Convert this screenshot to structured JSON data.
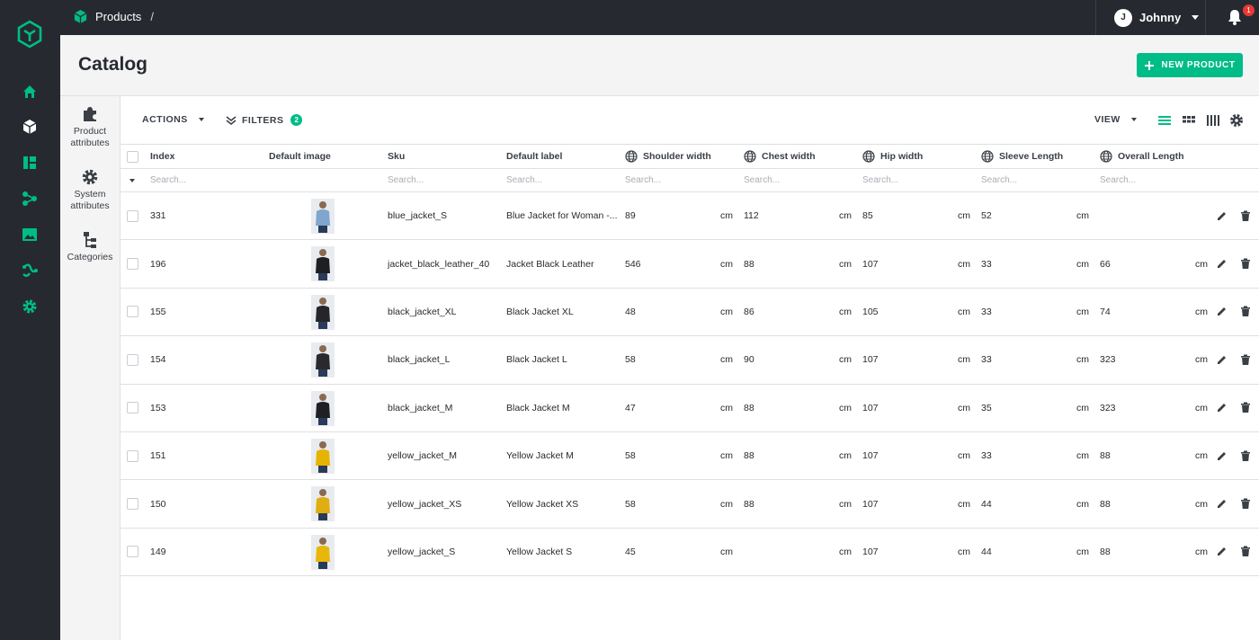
{
  "topbar": {
    "breadcrumb": "Products",
    "separator": "/",
    "user_initial": "J",
    "user_name": "Johnny",
    "notification_count": "1"
  },
  "header": {
    "title": "Catalog",
    "new_product_label": "NEW PRODUCT"
  },
  "sidepanel": [
    {
      "label": "Product attributes",
      "icon": "puzzle-icon"
    },
    {
      "label": "System attributes",
      "icon": "gear-icon"
    },
    {
      "label": "Categories",
      "icon": "tree-icon"
    }
  ],
  "toolbar": {
    "actions_label": "ACTIONS",
    "filters_label": "FILTERS",
    "filters_count": "2",
    "view_label": "VIEW"
  },
  "columns": [
    "Index",
    "Default image",
    "Sku",
    "Default label",
    "Shoulder width",
    "Chest width",
    "Hip width",
    "Sleeve Length",
    "Overall Length"
  ],
  "search_placeholder": "Search...",
  "unit": "cm",
  "rows": [
    {
      "index": "331",
      "sku": "blue_jacket_S",
      "label": "Blue Jacket for Woman -...",
      "shoulder": "89",
      "chest": "112",
      "hip": "85",
      "sleeve": "52",
      "overall": "",
      "image_color": "#7fa6cc"
    },
    {
      "index": "196",
      "sku": "jacket_black_leather_40",
      "label": "Jacket Black Leather",
      "shoulder": "546",
      "chest": "88",
      "hip": "107",
      "sleeve": "33",
      "overall": "66",
      "image_color": "#1f1f22"
    },
    {
      "index": "155",
      "sku": "black_jacket_XL",
      "label": "Black Jacket XL",
      "shoulder": "48",
      "chest": "86",
      "hip": "105",
      "sleeve": "33",
      "overall": "74",
      "image_color": "#26262a"
    },
    {
      "index": "154",
      "sku": "black_jacket_L",
      "label": "Black Jacket L",
      "shoulder": "58",
      "chest": "90",
      "hip": "107",
      "sleeve": "33",
      "overall": "323",
      "image_color": "#2a2a2e"
    },
    {
      "index": "153",
      "sku": "black_jacket_M",
      "label": "Black Jacket M",
      "shoulder": "47",
      "chest": "88",
      "hip": "107",
      "sleeve": "35",
      "overall": "323",
      "image_color": "#202024"
    },
    {
      "index": "151",
      "sku": "yellow_jacket_M",
      "label": "Yellow Jacket M",
      "shoulder": "58",
      "chest": "88",
      "hip": "107",
      "sleeve": "33",
      "overall": "88",
      "image_color": "#e5b400"
    },
    {
      "index": "150",
      "sku": "yellow_jacket_XS",
      "label": "Yellow Jacket XS",
      "shoulder": "58",
      "chest": "88",
      "hip": "107",
      "sleeve": "44",
      "overall": "88",
      "image_color": "#e0ae10"
    },
    {
      "index": "149",
      "sku": "yellow_jacket_S",
      "label": "Yellow Jacket S",
      "shoulder": "45",
      "chest": "",
      "hip": "107",
      "sleeve": "44",
      "overall": "88",
      "image_color": "#e8b70a"
    }
  ],
  "colors": {
    "accent": "#00bc87",
    "nav_bg": "#262a30"
  }
}
